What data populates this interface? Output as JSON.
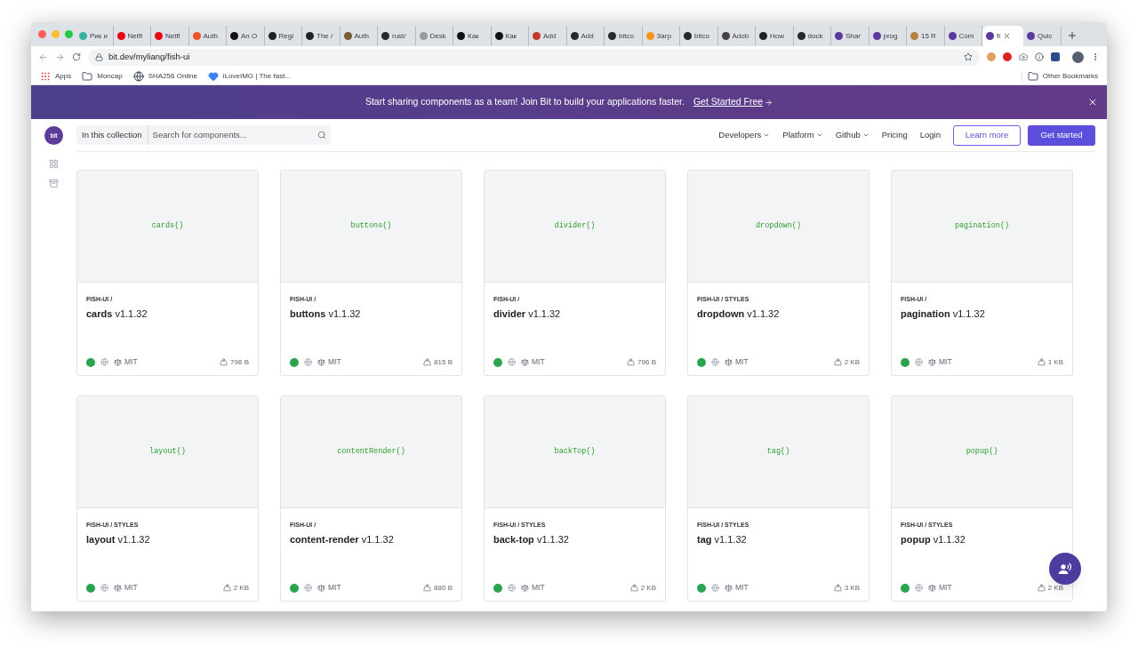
{
  "browser": {
    "tabs": [
      {
        "title": "Рик и",
        "color": "#3ab0a0",
        "selected": false
      },
      {
        "title": "Netfl",
        "color": "#e50914",
        "selected": false
      },
      {
        "title": "Netfl",
        "color": "#e50914",
        "selected": false
      },
      {
        "title": "Auth",
        "color": "#eb5424",
        "selected": false
      },
      {
        "title": "An O",
        "color": "#111111",
        "selected": false
      },
      {
        "title": "Regi",
        "color": "#222222",
        "selected": false
      },
      {
        "title": "The /",
        "color": "#222222",
        "selected": false
      },
      {
        "title": "Auth",
        "color": "#7a5c3a",
        "selected": false
      },
      {
        "title": "rust/",
        "color": "#24292e",
        "selected": false
      },
      {
        "title": "Desk",
        "color": "#9a9a9a",
        "selected": false
      },
      {
        "title": "Как",
        "color": "#111111",
        "selected": false
      },
      {
        "title": "Как",
        "color": "#111111",
        "selected": false
      },
      {
        "title": "Add",
        "color": "#c0392b",
        "selected": false
      },
      {
        "title": "Add",
        "color": "#24292e",
        "selected": false
      },
      {
        "title": "bitco",
        "color": "#24292e",
        "selected": false
      },
      {
        "title": "Загр",
        "color": "#f7931a",
        "selected": false
      },
      {
        "title": "bitco",
        "color": "#24292e",
        "selected": false
      },
      {
        "title": "Adob",
        "color": "#444444",
        "selected": false
      },
      {
        "title": "How",
        "color": "#222222",
        "selected": false
      },
      {
        "title": "dock",
        "color": "#24292e",
        "selected": false
      },
      {
        "title": "Shar",
        "color": "#5b3a9e",
        "selected": false
      },
      {
        "title": "prog",
        "color": "#5b3a9e",
        "selected": false
      },
      {
        "title": "15 R",
        "color": "#b5833f",
        "selected": false
      },
      {
        "title": "Com",
        "color": "#5b3a9e",
        "selected": false
      },
      {
        "title": "fi",
        "color": "#5b3a9e",
        "selected": true
      },
      {
        "title": "Quic",
        "color": "#5b3a9e",
        "selected": false
      }
    ],
    "address": "bit.dev/myliang/fish-ui",
    "bookmarks": [
      {
        "kind": "apps",
        "label": "Apps"
      },
      {
        "kind": "folder",
        "label": "Moncap"
      },
      {
        "kind": "globe",
        "label": "SHA256 Online"
      },
      {
        "kind": "heart",
        "label": "iLoveIMG | The fast..."
      }
    ],
    "other_bookmarks": "Other Bookmarks"
  },
  "banner": {
    "text": "Start sharing components as a team! Join Bit to build your applications faster.",
    "link": "Get Started Free"
  },
  "header": {
    "logo": "bit",
    "scope": "In this collection",
    "search": {
      "placeholder": "Search for components..."
    },
    "nav": [
      {
        "label": "Developers",
        "dropdown": true
      },
      {
        "label": "Platform",
        "dropdown": true
      },
      {
        "label": "Github",
        "dropdown": true
      },
      {
        "label": "Pricing",
        "dropdown": false
      },
      {
        "label": "Login",
        "dropdown": false
      }
    ],
    "secondary_button": "Learn more",
    "primary_button": "Get started"
  },
  "cards": [
    {
      "preview": "cards()",
      "scope": "FISH-UI /",
      "title": "**cards** v1.1.32",
      "license": "MIT",
      "size": "796 B"
    },
    {
      "preview": "buttons()",
      "scope": "FISH-UI /",
      "title": "**buttons** v1.1.32",
      "license": "MIT",
      "size": "815 B"
    },
    {
      "preview": "divider()",
      "scope": "FISH-UI /",
      "title": "**divider** v1.1.32",
      "license": "MIT",
      "size": "796 B"
    },
    {
      "preview": "dropdown()",
      "scope": "FISH-UI / STYLES",
      "title": "**dropdown** v1.1.32",
      "license": "MIT",
      "size": "2 KB"
    },
    {
      "preview": "pagination()",
      "scope": "FISH-UI /",
      "title": "**pagination** v1.1.32",
      "license": "MIT",
      "size": "1 KB"
    },
    {
      "preview": "layout()",
      "scope": "FISH-UI / STYLES",
      "title": "**layout** v1.1.32",
      "license": "MIT",
      "size": "2 KB"
    },
    {
      "preview": "contentRender()",
      "scope": "FISH-UI /",
      "title": "**content-render** v1.1.32",
      "license": "MIT",
      "size": "880 B"
    },
    {
      "preview": "backTop()",
      "scope": "FISH-UI / STYLES",
      "title": "**back-top** v1.1.32",
      "license": "MIT",
      "size": "2 KB"
    },
    {
      "preview": "tag()",
      "scope": "FISH-UI / STYLES",
      "title": "**tag** v1.1.32",
      "license": "MIT",
      "size": "3 KB"
    },
    {
      "preview": "popup()",
      "scope": "FISH-UI / STYLES",
      "title": "**popup** v1.1.32",
      "license": "MIT",
      "size": "2 KB"
    }
  ]
}
